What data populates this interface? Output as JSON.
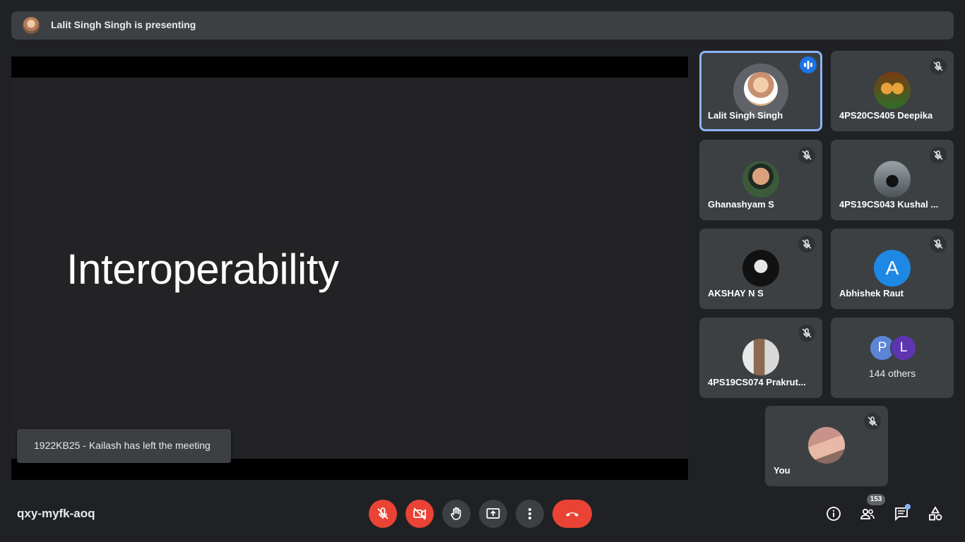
{
  "banner": {
    "text": "Lalit Singh Singh is presenting"
  },
  "presentation": {
    "slide_title": "Interoperability"
  },
  "toast": {
    "text": "1922KB25 - Kailash has left the meeting"
  },
  "participants": [
    {
      "name": "Lalit Singh Singh",
      "speaking": true
    },
    {
      "name": "4PS20CS405 Deepika",
      "muted": true
    },
    {
      "name": "Ghanashyam S",
      "muted": true
    },
    {
      "name": "4PS19CS043 Kushal ...",
      "muted": true
    },
    {
      "name": "AKSHAY N S",
      "muted": true
    },
    {
      "name": "Abhishek Raut",
      "muted": true,
      "initial": "A",
      "color": "#1e88e5"
    },
    {
      "name": "4PS19CS074 Prakrut...",
      "muted": true
    },
    {
      "name": "You",
      "muted": true
    }
  ],
  "others_tile": {
    "initials": [
      "P",
      "L"
    ],
    "colors": [
      "#5c85d6",
      "#5e35b1"
    ],
    "label": "144 others"
  },
  "meeting_code": "qxy-myfk-aoq",
  "controls": [
    "mic-off",
    "camera-off",
    "raise-hand",
    "present-now",
    "more-options",
    "leave-call"
  ],
  "right_controls": {
    "people_count": "153",
    "items": [
      "meeting-details",
      "people",
      "chat",
      "activities"
    ]
  },
  "colors": {
    "accent": "#8ab4f8",
    "danger": "#ea4335",
    "surface": "#3c4043",
    "background": "#202124"
  }
}
